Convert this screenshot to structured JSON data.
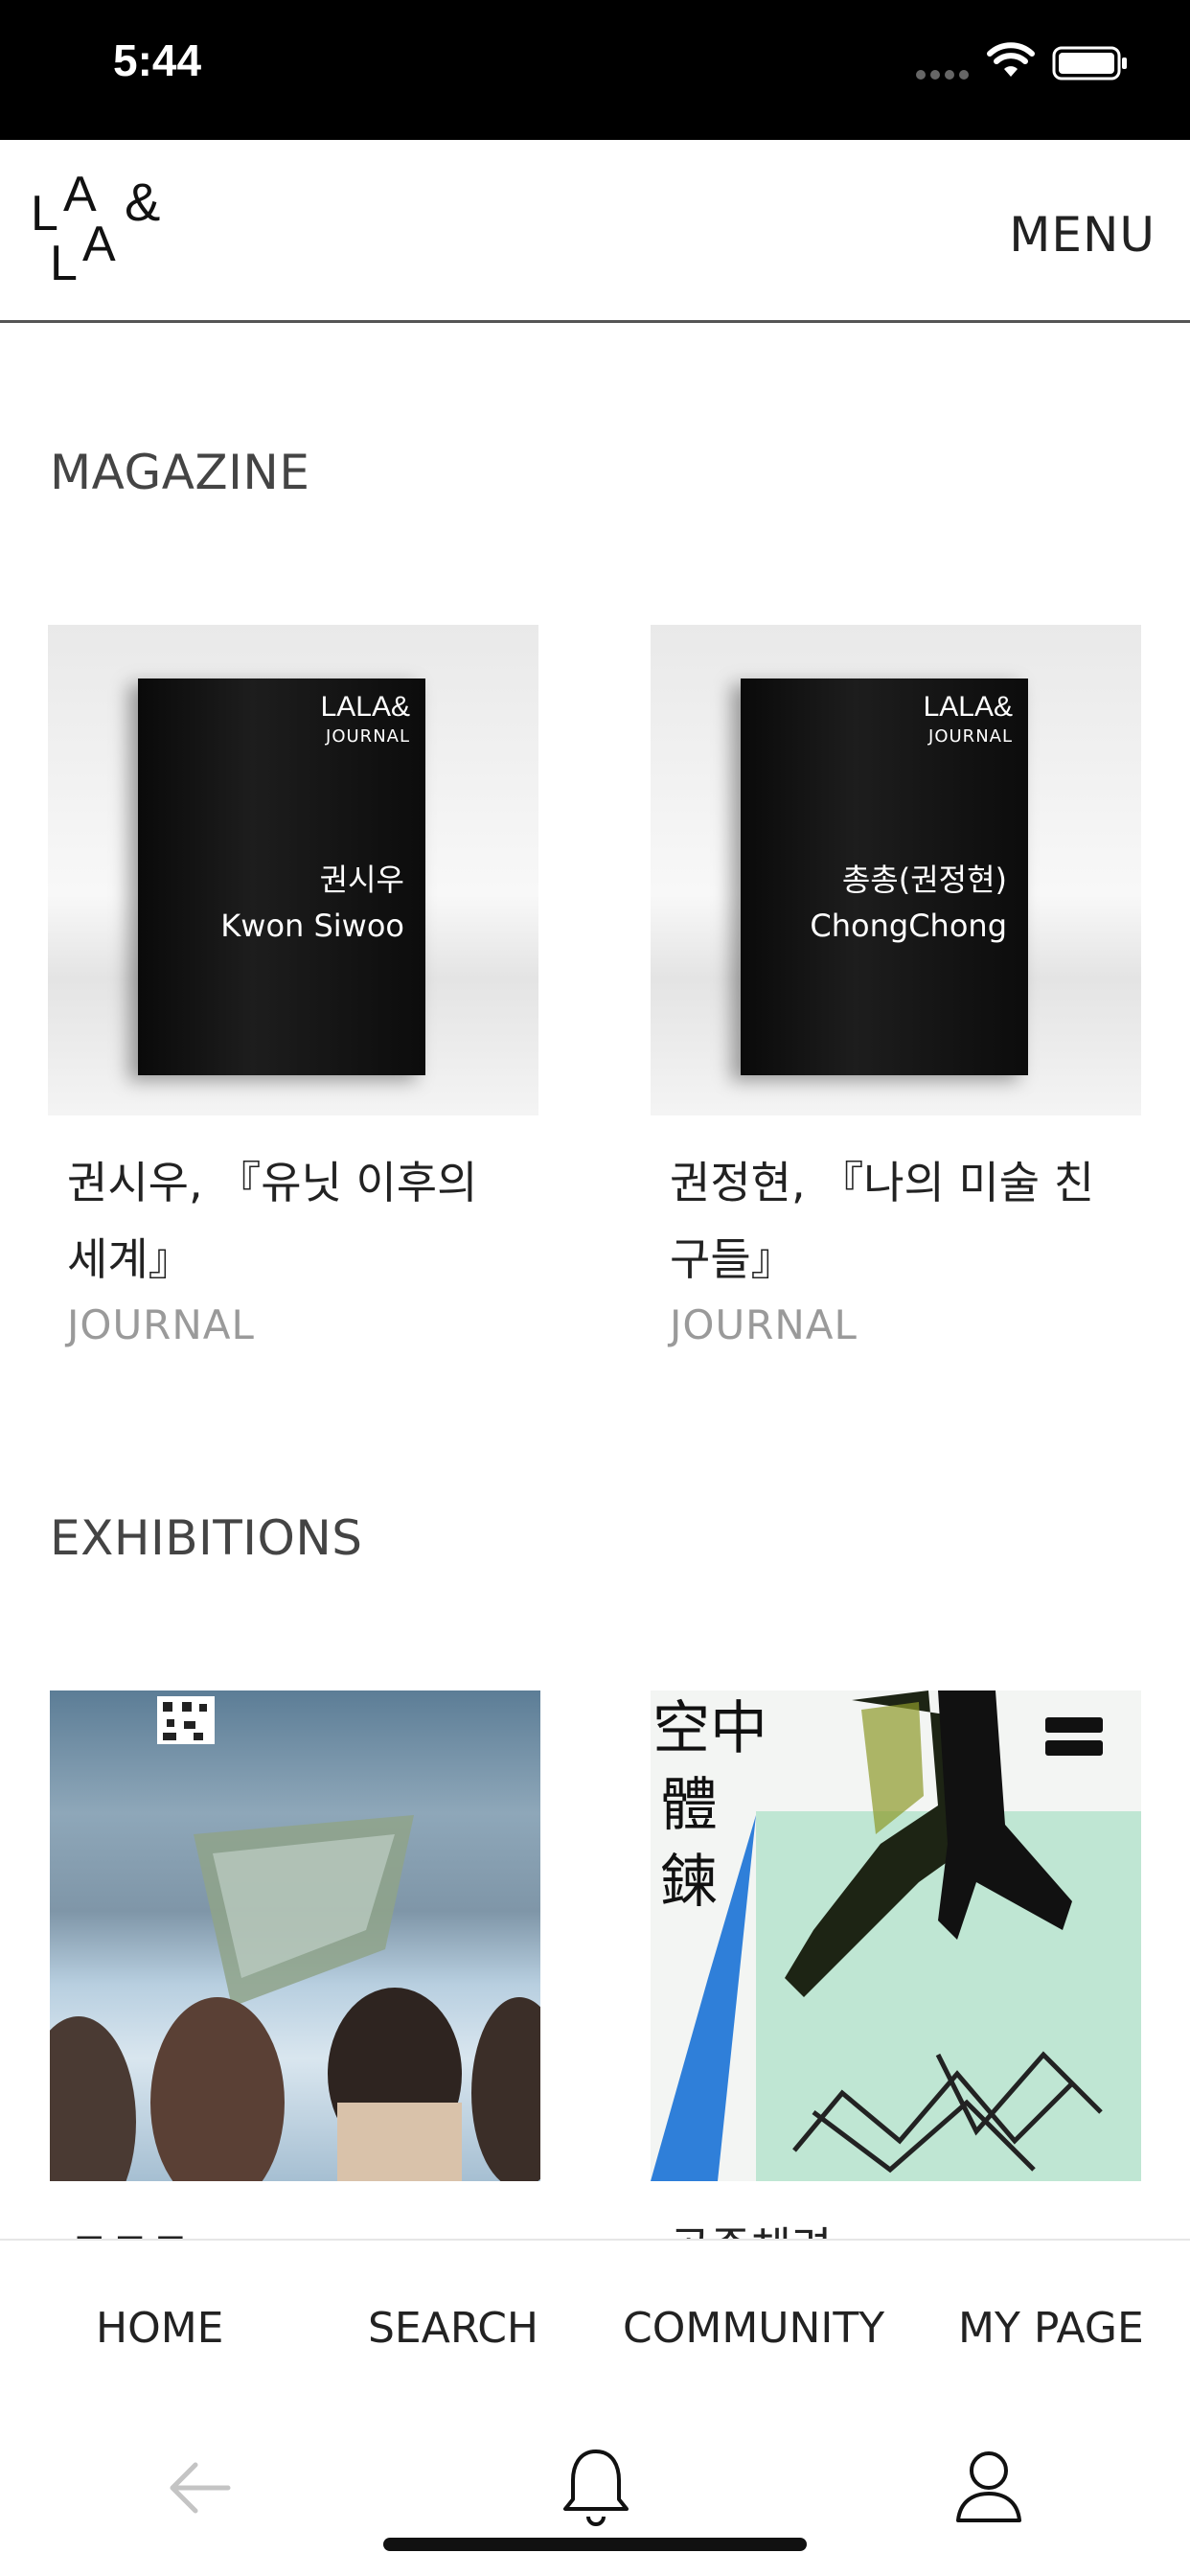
{
  "status_bar": {
    "time": "5:44"
  },
  "header": {
    "logo_text": "LALA&",
    "menu_label": "MENU"
  },
  "magazine": {
    "section_title": "MAGAZINE",
    "items": [
      {
        "cover_brand": "LALA&",
        "cover_journal_label": "JOURNAL",
        "cover_name_ko": "권시우",
        "cover_name_en": "Kwon Siwoo",
        "title": "권시우, 『유닛 이후의 세계』",
        "category": "JOURNAL"
      },
      {
        "cover_brand": "LALA&",
        "cover_journal_label": "JOURNAL",
        "cover_name_ko": "총총(권정현)",
        "cover_name_en": "ChongChong",
        "title": "권정현, 『나의 미술 친구들』",
        "category": "JOURNAL"
      }
    ]
  },
  "exhibitions": {
    "section_title": "EXHIBITIONS",
    "items": [
      {
        "title": "ㄷㄷㄷ"
      },
      {
        "title": "공중체련"
      }
    ]
  },
  "tab_nav": {
    "home": "HOME",
    "search": "SEARCH",
    "community": "COMMUNITY",
    "my_page": "MY PAGE"
  },
  "icons": {
    "back": "back-arrow-icon",
    "notifications": "bell-icon",
    "profile": "user-icon"
  }
}
